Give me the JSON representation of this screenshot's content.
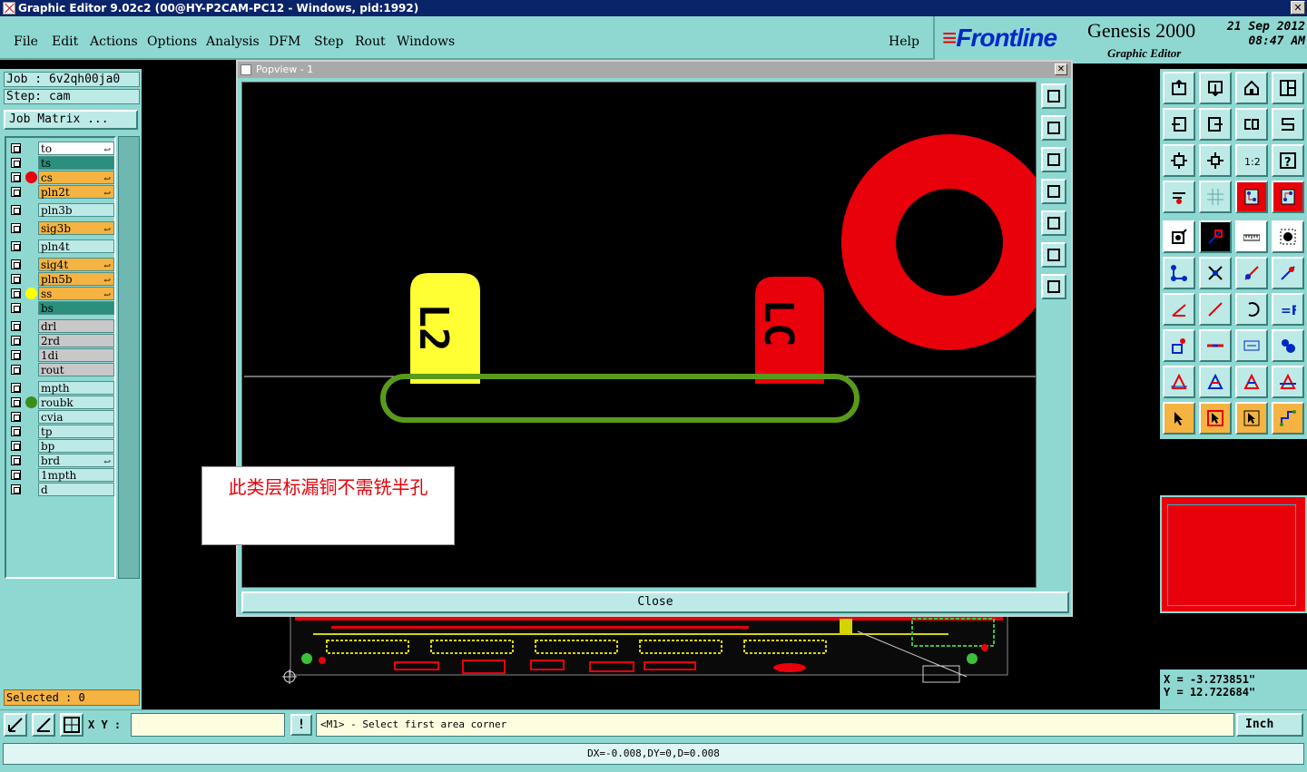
{
  "window": {
    "title": "Graphic Editor 9.02c2 (00@HY-P2CAM-PC12 - Windows, pid:1992)",
    "close_glyph": "✕"
  },
  "menu": [
    {
      "label": "File"
    },
    {
      "label": "Edit"
    },
    {
      "label": "Actions"
    },
    {
      "label": "Options"
    },
    {
      "label": "Analysis"
    },
    {
      "label": "DFM"
    },
    {
      "label": "Step"
    },
    {
      "label": "Rout"
    },
    {
      "label": "Windows"
    },
    {
      "label": "Help"
    }
  ],
  "brand": {
    "logo": "Frontline",
    "title": "Genesis 2000",
    "subtitle": "Graphic Editor",
    "date": "21 Sep 2012",
    "time": "08:47 AM"
  },
  "left": {
    "job": "Job : 6v2qh00ja0",
    "step": "Step: cam",
    "job_matrix": "Job Matrix ...",
    "selected": "Selected : 0"
  },
  "layers": [
    {
      "name": "to",
      "bg": "#ffffff",
      "dot": "",
      "mark": "↩"
    },
    {
      "name": "ts",
      "bg": "#2b8f7d",
      "dot": "",
      "mark": ""
    },
    {
      "name": "cs",
      "bg": "#f5b342",
      "dot": "#e8000a",
      "mark": "↩"
    },
    {
      "name": "pln2t",
      "bg": "#f5b342",
      "dot": "",
      "mark": "↩"
    },
    {
      "name": "pln3b",
      "bg": "#bdeae6",
      "dot": "",
      "mark": ""
    },
    {
      "name": "sig3b",
      "bg": "#f5b342",
      "dot": "",
      "mark": "↩"
    },
    {
      "name": "pln4t",
      "bg": "#bdeae6",
      "dot": "",
      "mark": ""
    },
    {
      "name": "sig4t",
      "bg": "#f5b342",
      "dot": "",
      "mark": "↩"
    },
    {
      "name": "pln5b",
      "bg": "#f5b342",
      "dot": "",
      "mark": "↩"
    },
    {
      "name": "ss",
      "bg": "#f5b342",
      "dot": "#ffff00",
      "mark": "↩"
    },
    {
      "name": "bs",
      "bg": "#2b8f7d",
      "dot": "",
      "mark": ""
    },
    {
      "name": "drl",
      "bg": "#c8c8c8",
      "dot": "",
      "mark": ""
    },
    {
      "name": "2rd",
      "bg": "#c8c8c8",
      "dot": "",
      "mark": ""
    },
    {
      "name": "1di",
      "bg": "#c8c8c8",
      "dot": "",
      "mark": ""
    },
    {
      "name": "rout",
      "bg": "#c8c8c8",
      "dot": "",
      "mark": ""
    },
    {
      "name": "mpth",
      "bg": "#bdeae6",
      "dot": "",
      "mark": ""
    },
    {
      "name": "roubk",
      "bg": "#bdeae6",
      "dot": "#3a8f1a",
      "mark": ""
    },
    {
      "name": "cvia",
      "bg": "#bdeae6",
      "dot": "",
      "mark": ""
    },
    {
      "name": "tp",
      "bg": "#bdeae6",
      "dot": "",
      "mark": ""
    },
    {
      "name": "bp",
      "bg": "#bdeae6",
      "dot": "",
      "mark": ""
    },
    {
      "name": "brd",
      "bg": "#bdeae6",
      "dot": "",
      "mark": "↩"
    },
    {
      "name": "1mpth",
      "bg": "#bdeae6",
      "dot": "",
      "mark": ""
    },
    {
      "name": "d",
      "bg": "#bdeae6",
      "dot": "",
      "mark": ""
    }
  ],
  "popview": {
    "title": "Popview - 1",
    "close_glyph": "✕",
    "close_button": "Close",
    "labels": {
      "left_pad": "L2",
      "right_pad": "LC"
    }
  },
  "note": "此类层标漏铜不需铣半孔",
  "coords": {
    "x": "X  = -3.273851\"",
    "y": "Y  = 12.722684\""
  },
  "bottom": {
    "xy_label": "X Y :",
    "xy_value": "",
    "bang": "!",
    "prompt": "<M1> - Select first area corner",
    "units": "Inch",
    "status": "DX=-0.008,DY=0,D=0.008"
  },
  "colors": {
    "teal": "#8fd8d2",
    "light_teal": "#bdeae6",
    "red_layer": "#e8000a",
    "yellow_layer": "#ffff33",
    "green_outline": "#5a9a1a"
  }
}
